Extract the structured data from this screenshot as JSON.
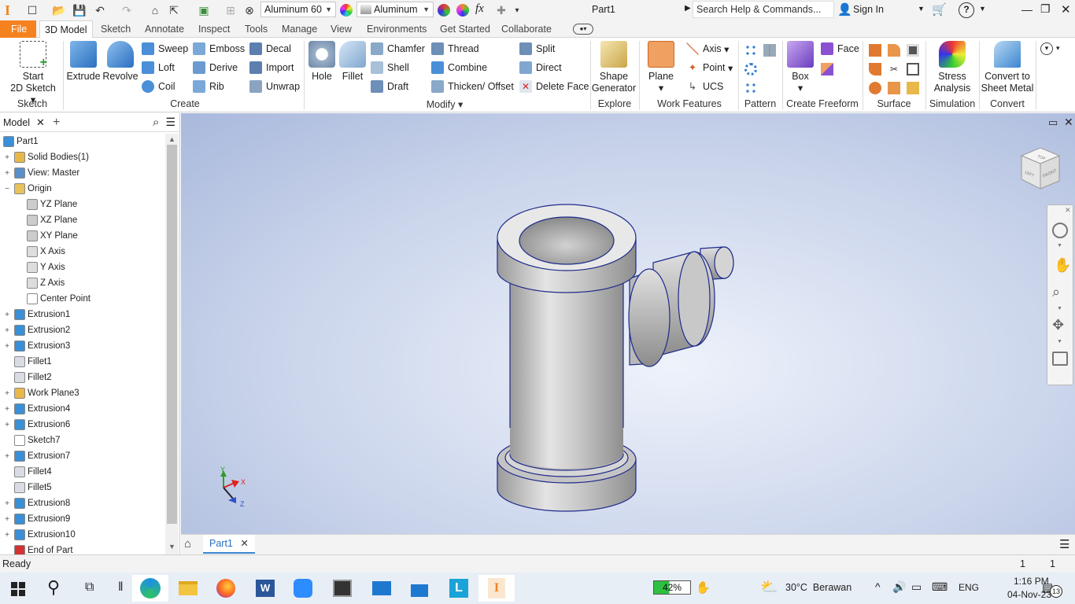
{
  "title_bar": {
    "app_letter": "I",
    "material": "Aluminum 60",
    "appearance": "Aluminum",
    "fx": "fx",
    "doc_title": "Part1",
    "search_placeholder": "Search Help & Commands...",
    "sign_in": "Sign In"
  },
  "ribbon_tabs": [
    "File",
    "3D Model",
    "Sketch",
    "Annotate",
    "Inspect",
    "Tools",
    "Manage",
    "View",
    "Environments",
    "Get Started",
    "Collaborate"
  ],
  "ribbon": {
    "sketch": {
      "start_line1": "Start",
      "start_line2": "2D Sketch",
      "group": "Sketch"
    },
    "create": {
      "extrude": "Extrude",
      "revolve": "Revolve",
      "sweep": "Sweep",
      "emboss": "Emboss",
      "decal": "Decal",
      "loft": "Loft",
      "derive": "Derive",
      "import": "Import",
      "coil": "Coil",
      "rib": "Rib",
      "unwrap": "Unwrap",
      "group": "Create"
    },
    "modify": {
      "hole": "Hole",
      "fillet": "Fillet",
      "chamfer": "Chamfer",
      "thread": "Thread",
      "split": "Split",
      "shell": "Shell",
      "combine": "Combine",
      "direct": "Direct",
      "draft": "Draft",
      "thicken": "Thicken/ Offset",
      "delete_face": "Delete Face",
      "group": "Modify"
    },
    "explore": {
      "line1": "Shape",
      "line2": "Generator",
      "group": "Explore"
    },
    "work": {
      "plane": "Plane",
      "axis": "Axis",
      "point": "Point",
      "ucs": "UCS",
      "group": "Work Features"
    },
    "pattern": {
      "group": "Pattern"
    },
    "freeform": {
      "box": "Box",
      "face": "Face",
      "group": "Create Freeform"
    },
    "surface": {
      "group": "Surface"
    },
    "simulation": {
      "line1": "Stress",
      "line2": "Analysis",
      "group": "Simulation"
    },
    "convert": {
      "line1": "Convert to",
      "line2": "Sheet Metal",
      "group": "Convert"
    }
  },
  "browser": {
    "tab": "Model",
    "nodes": [
      {
        "label": "Part1",
        "level": 0,
        "exp": "",
        "color": "#3a8fd6"
      },
      {
        "label": "Solid Bodies(1)",
        "level": 1,
        "exp": "+",
        "color": "#e8b84a"
      },
      {
        "label": "View: Master",
        "level": 1,
        "exp": "+",
        "color": "#5b8fc9"
      },
      {
        "label": "Origin",
        "level": 1,
        "exp": "−",
        "color": "#e8c25a"
      },
      {
        "label": "YZ Plane",
        "level": 2,
        "exp": "",
        "color": "#cccccc"
      },
      {
        "label": "XZ Plane",
        "level": 2,
        "exp": "",
        "color": "#cccccc"
      },
      {
        "label": "XY Plane",
        "level": 2,
        "exp": "",
        "color": "#cccccc"
      },
      {
        "label": "X Axis",
        "level": 2,
        "exp": "",
        "color": "#dddddd"
      },
      {
        "label": "Y Axis",
        "level": 2,
        "exp": "",
        "color": "#dddddd"
      },
      {
        "label": "Z Axis",
        "level": 2,
        "exp": "",
        "color": "#dddddd"
      },
      {
        "label": "Center Point",
        "level": 2,
        "exp": "",
        "color": "#ffffff"
      },
      {
        "label": "Extrusion1",
        "level": 1,
        "exp": "+",
        "color": "#3a8fd6"
      },
      {
        "label": "Extrusion2",
        "level": 1,
        "exp": "+",
        "color": "#3a8fd6"
      },
      {
        "label": "Extrusion3",
        "level": 1,
        "exp": "+",
        "color": "#3a8fd6"
      },
      {
        "label": "Fillet1",
        "level": 1,
        "exp": "",
        "color": "#d9dde3"
      },
      {
        "label": "Fillet2",
        "level": 1,
        "exp": "",
        "color": "#d9dde3"
      },
      {
        "label": "Work Plane3",
        "level": 1,
        "exp": "+",
        "color": "#e8b84a"
      },
      {
        "label": "Extrusion4",
        "level": 1,
        "exp": "+",
        "color": "#3a8fd6"
      },
      {
        "label": "Extrusion6",
        "level": 1,
        "exp": "+",
        "color": "#3a8fd6"
      },
      {
        "label": "Sketch7",
        "level": 1,
        "exp": "",
        "color": "#ffffff"
      },
      {
        "label": "Extrusion7",
        "level": 1,
        "exp": "+",
        "color": "#3a8fd6"
      },
      {
        "label": "Fillet4",
        "level": 1,
        "exp": "",
        "color": "#d9dde3"
      },
      {
        "label": "Fillet5",
        "level": 1,
        "exp": "",
        "color": "#d9dde3"
      },
      {
        "label": "Extrusion8",
        "level": 1,
        "exp": "+",
        "color": "#3a8fd6"
      },
      {
        "label": "Extrusion9",
        "level": 1,
        "exp": "+",
        "color": "#3a8fd6"
      },
      {
        "label": "Extrusion10",
        "level": 1,
        "exp": "+",
        "color": "#3a8fd6"
      },
      {
        "label": "End of Part",
        "level": 1,
        "exp": "",
        "color": "#d33333"
      }
    ]
  },
  "viewcube": {
    "top": "TOP",
    "front": "FRONT",
    "left": "LEFT"
  },
  "triad": {
    "x": "X",
    "y": "Y",
    "z": "Z"
  },
  "doc_tab": "Part1",
  "status": {
    "text": "Ready",
    "n1": "1",
    "n2": "1"
  },
  "taskbar": {
    "battery": "42%",
    "weather": "30°C  Berawan",
    "lang": "ENG",
    "time": "1:16 PM",
    "date": "04-Nov-23",
    "notif": "13"
  },
  "colors": {
    "accent": "#f5821f",
    "viewport_edge": "#1e2a8a"
  }
}
